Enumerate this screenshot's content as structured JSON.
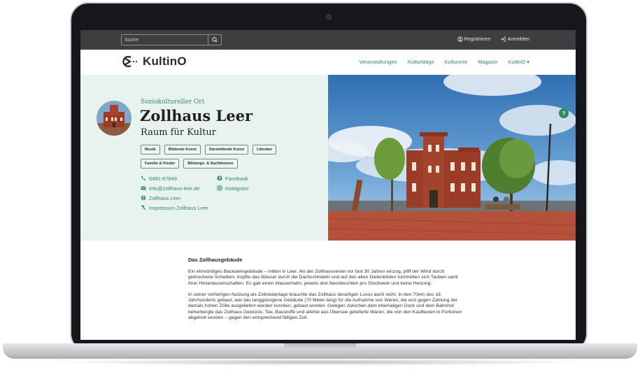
{
  "topbar": {
    "search_placeholder": "Suche",
    "register_label": "Registrieren",
    "login_label": "Anmelden"
  },
  "nav": {
    "logo_text": "KultinO",
    "items": [
      {
        "label": "Veranstaltungen"
      },
      {
        "label": "Kulturtätige"
      },
      {
        "label": "Kulturorte"
      },
      {
        "label": "Magazin"
      },
      {
        "label": "KultinO ▾"
      }
    ]
  },
  "profile": {
    "category": "Soziokultureller Ort",
    "title": "Zollhaus Leer",
    "subtitle": "Raum für Kultur",
    "tags": [
      {
        "label": "Musik"
      },
      {
        "label": "Bildende Kunst"
      },
      {
        "label": "Darstellende Kunst"
      },
      {
        "label": "Literatur"
      },
      {
        "label": "Familie & Kinder"
      },
      {
        "label": "Bildungs- & Sachthemen"
      }
    ],
    "contacts": {
      "phone": "0491-67649",
      "email": "info@zollhaus-leer.de",
      "website": "Zollhaus Leer",
      "imprint": "Impressum Zollhaus Leer",
      "facebook": "Facebook",
      "instagram": "Instagram"
    },
    "help_label": "?"
  },
  "article": {
    "title": "Das Zollhausgebäude",
    "paragraphs": [
      "Ein ehrwürdiges Backsteingebäude – mitten in Leer. Als der Zollhausverein vor fast 30 Jahren einzog, pfiff der Wind durch gebrochene Scheiben, tropfte das Wasser durch die Dachschindeln und auf den alten Dielenböden tummelten sich Tauben samt ihrer Hinterlassenschaften. Es gab einen  Wasserhahn, jeweils drei Neonleuchten pro Stockwerk und keine Heizung.",
      "In seiner vorherigen Nutzung als Zollniederlage brauchte das Zollhaus derartigen Luxus auch nicht. In den 70ern des 19. Jahrhunderts gebaut, war das langgezogene Gebäude (70 Meter lang) für die Aufnahme von Waren, die erst gegen Zahlung der damals hohen Zölle ausgeliefert werden konnten, gebaut worden. Gelegen zwischen dem ehemaligen Dock und dem Bahnhof, beherbergte das Zollhaus Gewürze, Tee, Baustoffe und allerlei aus Übersee gelieferte Waren, die von den Kaufleuten in Portionen abgeholt wurden – gegen den entsprechend fälligen Zoll."
    ]
  },
  "colors": {
    "accent": "#2f8a63",
    "topbar": "#3d3e40",
    "hero_bg": "#e8f3ef"
  }
}
